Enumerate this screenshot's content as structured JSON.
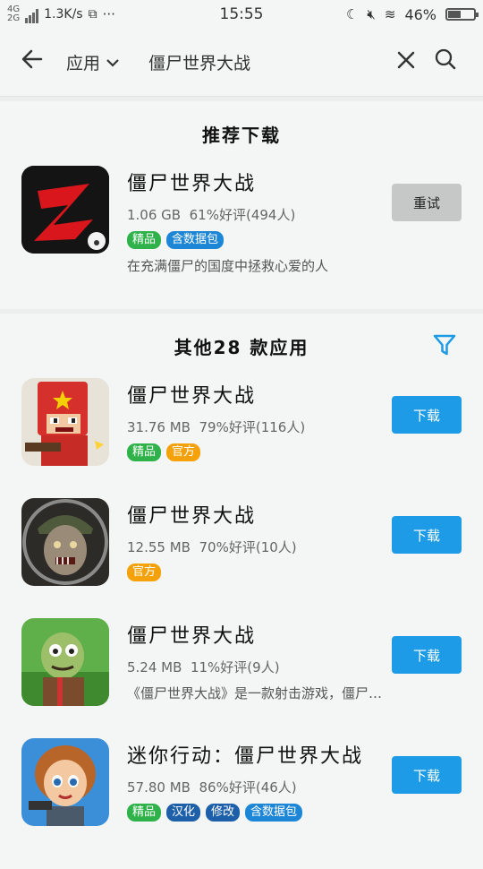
{
  "status_bar": {
    "network_top": "4G",
    "network_bottom": "2G",
    "speed": "1.3K/s",
    "time": "15:55",
    "battery": "46%",
    "battery_level": 0.46
  },
  "search": {
    "scope": "应用",
    "query": "僵尸世界大战"
  },
  "recommended": {
    "title": "推荐下载",
    "app": {
      "name": "僵尸世界大战",
      "size": "1.06 GB",
      "rating": "61%好评(494人)",
      "tags": [
        {
          "label": "精品",
          "color": "#2fb24a"
        },
        {
          "label": "含数据包",
          "color": "#1e86d6"
        }
      ],
      "description": "在充满僵尸的国度中拯救心爱的人",
      "action": "重试"
    }
  },
  "others": {
    "title": "其他28 款应用",
    "apps": [
      {
        "name": "僵尸世界大战",
        "size": "31.76 MB",
        "rating": "79%好评(116人)",
        "tags": [
          {
            "label": "精品",
            "color": "#2fb24a"
          },
          {
            "label": "官方",
            "color": "#f5a20a"
          }
        ],
        "description": "",
        "action": "下载"
      },
      {
        "name": "僵尸世界大战",
        "size": "12.55 MB",
        "rating": "70%好评(10人)",
        "tags": [
          {
            "label": "官方",
            "color": "#f5a20a"
          }
        ],
        "description": "",
        "action": "下载"
      },
      {
        "name": "僵尸世界大战",
        "size": "5.24 MB",
        "rating": "11%好评(9人)",
        "tags": [],
        "description": "《僵尸世界大战》是一款射击游戏，僵尸入…",
        "action": "下载"
      },
      {
        "name": "迷你行动：僵尸世界大战",
        "size": "57.80 MB",
        "rating": "86%好评(46人)",
        "tags": [
          {
            "label": "精品",
            "color": "#2fb24a"
          },
          {
            "label": "汉化",
            "color": "#1d5fa8"
          },
          {
            "label": "修改",
            "color": "#1d5fa8"
          },
          {
            "label": "含数据包",
            "color": "#1e86d6"
          }
        ],
        "description": "",
        "action": "下载"
      }
    ]
  }
}
